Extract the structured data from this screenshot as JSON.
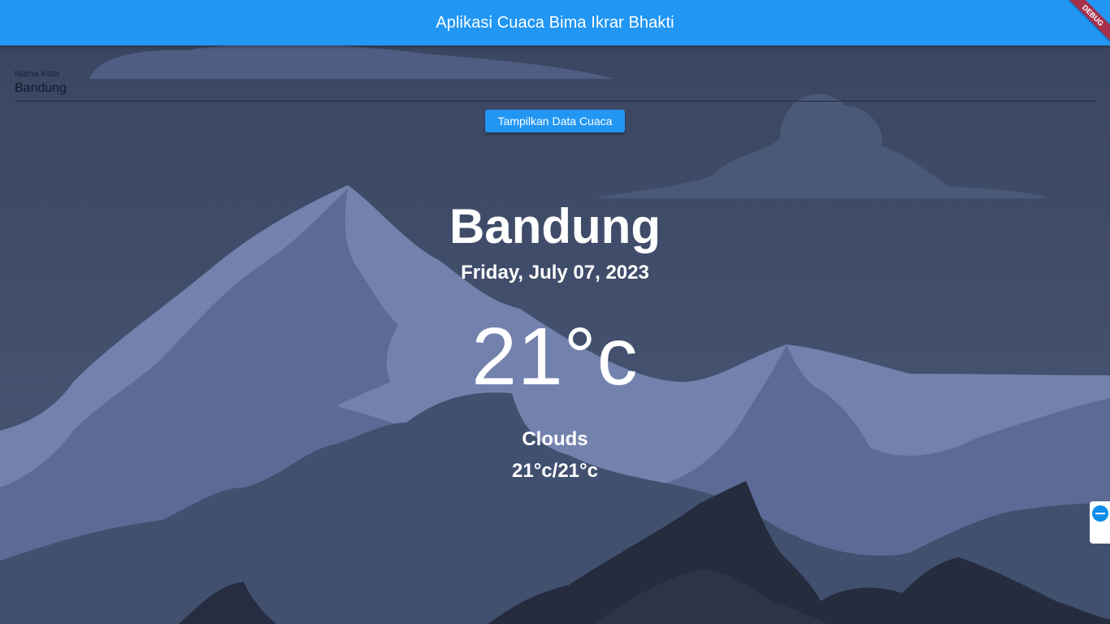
{
  "appbar": {
    "title": "Aplikasi Cuaca Bima Ikrar Bhakti",
    "debug_label": "DEBUG",
    "color": "#2196f3"
  },
  "form": {
    "label": "Nama Kota",
    "value": "Bandung"
  },
  "button": {
    "label": "Tampilkan Data Cuaca"
  },
  "weather": {
    "city": "Bandung",
    "date": "Friday, July 07, 2023",
    "temperature": "21°c",
    "condition": "Clouds",
    "min_max": "21°c/21°c"
  },
  "side_widget": {
    "icon": "remote-support-icon"
  }
}
